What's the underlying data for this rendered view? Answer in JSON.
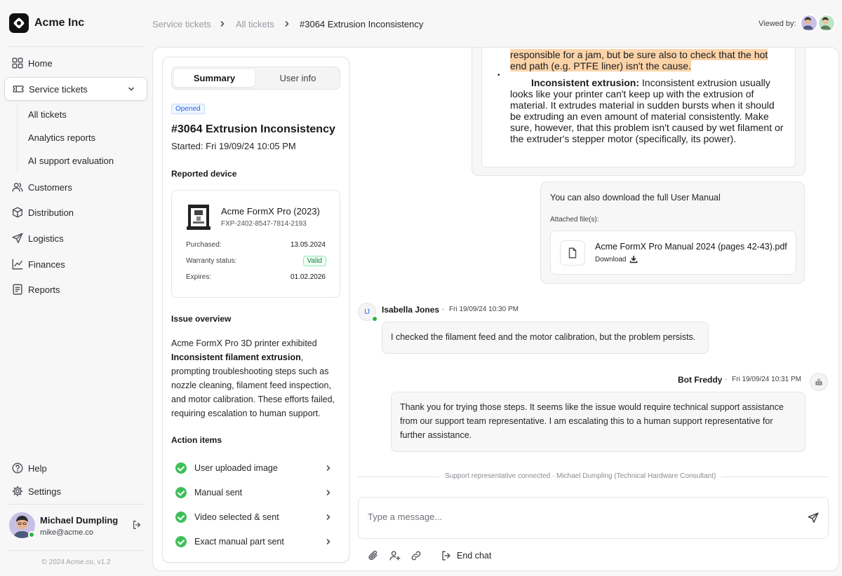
{
  "app": {
    "name": "Acme Inc",
    "footer": "© 2024 Acme.co, v1.2"
  },
  "sidebar": {
    "items": [
      {
        "label": "Home",
        "icon": "grid-icon"
      },
      {
        "label": "Service tickets",
        "icon": "ticket-icon",
        "expanded": true
      },
      {
        "label": "Customers",
        "icon": "users-icon"
      },
      {
        "label": "Distribution",
        "icon": "box-icon"
      },
      {
        "label": "Logistics",
        "icon": "send-icon"
      },
      {
        "label": "Finances",
        "icon": "chart-icon"
      },
      {
        "label": "Reports",
        "icon": "report-icon"
      }
    ],
    "sub_items": [
      "All tickets",
      "Analytics reports",
      "AI support evaluation"
    ],
    "bottom": [
      {
        "label": "Help",
        "icon": "help-icon"
      },
      {
        "label": "Settings",
        "icon": "gear-icon"
      }
    ],
    "user": {
      "name": "Michael Dumpling",
      "email": "mike@acme.co"
    }
  },
  "header": {
    "breadcrumb": [
      "Service tickets",
      "All tickets",
      "#3064 Extrusion Inconsistency"
    ],
    "viewed_by": "Viewed by:"
  },
  "detail": {
    "tabs": [
      "Summary",
      "User info"
    ],
    "status": "Opened",
    "title": "#3064 Extrusion Inconsistency",
    "started": "Started: Fri 19/09/24 10:05 PM",
    "device_heading": "Reported device",
    "device": {
      "name": "Acme FormX Pro (2023)",
      "serial": "FXP-2402-8547-7814-2193",
      "purchased_label": "Purchased:",
      "purchased": "13.05.2024",
      "warranty_label": "Warranty status:",
      "warranty": "Valid",
      "expires_label": "Expires:",
      "expires": "01.02.2026"
    },
    "overview_heading": "Issue overview",
    "overview_pre": "Acme FormX Pro 3D printer exhibited ",
    "overview_bold": "Inconsistent filament extrusion",
    "overview_post": ", prompting troubleshooting steps such as nozzle cleaning, filament feed inspection, and motor calibration. These efforts failed, requiring escalation to human support.",
    "actions_heading": "Action items",
    "actions": [
      "User uploaded image",
      "Manual sent",
      "Video selected & sent",
      "Exact manual part sent"
    ]
  },
  "chat": {
    "quote": {
      "line1": "responsible for a jam, but be sure also to check that the hot",
      "line2": "end path (e.g. PTFE liner) isn't the cause.",
      "bullet_title": "Inconsistent extrusion:",
      "bullet_l1": " Inconsistent extrusion usually",
      "bullet_l2": "looks like your printer can't keep up with the extrusion of",
      "bullet_l3": "material. It extrudes material in sudden bursts when it should",
      "bullet_l4": "be extruding an even amount of material consistently. Make",
      "bullet_l5": "sure, however, that this problem isn't caused by wet filament or",
      "bullet_l6": "the extruder's stepper motor (specifically, its power)."
    },
    "download": {
      "message": "You can also download the full User Manual",
      "attached_label": "Attached file(s):",
      "file_name": "Acme FormX Pro Manual 2024 (pages 42-43).pdf",
      "download_label": "Download"
    },
    "user_msg": {
      "initials": "IJ",
      "name": "Isabella Jones",
      "time": "Fri 19/09/24 10:30 PM",
      "text": "I checked the filament feed and the motor calibration, but the problem persists."
    },
    "bot_msg": {
      "name": "Bot Freddy",
      "time": "Fri 19/09/24 10:31 PM",
      "text": "Thank you for trying those steps. It seems like the issue would require technical support assistance from our support team representative. I am escalating this to a human support representative for further assistance."
    },
    "dot": "·",
    "system": "Support representative connected  ·  Michael Dumpling (Technical Hardware Consultant)",
    "composer_placeholder": "Type a message...",
    "end_chat": "End chat"
  },
  "colors": {
    "highlight": "#fbd3a8",
    "online": "#2fb344",
    "check": "#3fbf5a",
    "opened_badge": "#2563eb"
  }
}
